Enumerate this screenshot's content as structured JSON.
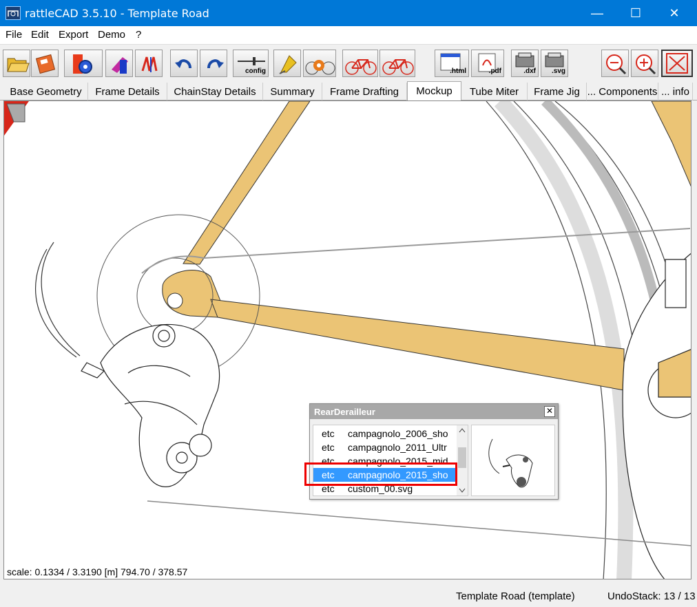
{
  "window": {
    "title": "rattleCAD  3.5.10 - Template Road",
    "minimize_glyph": "—",
    "maximize_glyph": "☐",
    "close_glyph": "✕"
  },
  "menu": {
    "items": [
      "File",
      "Edit",
      "Export",
      "Demo",
      "?"
    ]
  },
  "toolbar": {
    "config_label": "config",
    "html_label": ".html",
    "pdf_label": ".pdf",
    "dxf_label": ".dxf",
    "svg_label": ".svg",
    "icons": [
      "open-folder-icon",
      "save-disk-icon",
      "settings-gear-icon",
      "tube-icon",
      "tool-icon",
      "undo-icon",
      "redo-icon",
      "config-icon",
      "render-icon",
      "bike-fit-icon",
      "bike-red-icon",
      "bike-red-2-icon",
      "export-html-icon",
      "export-pdf-icon",
      "export-dxf-icon",
      "export-svg-icon",
      "zoom-out-icon",
      "zoom-in-icon",
      "fit-screen-icon"
    ]
  },
  "tabs": [
    {
      "label": "Base Geometry"
    },
    {
      "label": "Frame Details"
    },
    {
      "label": "ChainStay Details"
    },
    {
      "label": "Summary"
    },
    {
      "label": "Frame Drafting"
    },
    {
      "label": "Mockup"
    },
    {
      "label": "Tube Miter"
    },
    {
      "label": "Frame Jig"
    },
    {
      "label": "... Components"
    },
    {
      "label": "... info"
    }
  ],
  "active_tab": "Mockup",
  "canvas": {
    "scale_text": "scale: 0.1334 / 3.3190  [m]  794.70 / 378.57",
    "frame_color": "#ebc475"
  },
  "dialog": {
    "title": "RearDerailleur",
    "close_glyph": "✕",
    "rows": [
      {
        "col1": "etc",
        "col2": "campagnolo_2006_sho"
      },
      {
        "col1": "etc",
        "col2": "campagnolo_2011_Ultr"
      },
      {
        "col1": "etc",
        "col2": "campagnolo_2015_mid"
      },
      {
        "col1": "etc",
        "col2": "campagnolo_2015_sho"
      },
      {
        "col1": "etc",
        "col2": "custom_00.svg"
      }
    ],
    "selected_index": 3
  },
  "status": {
    "project": "Template Road (template)",
    "undo": "UndoStack: 13 / 13"
  }
}
